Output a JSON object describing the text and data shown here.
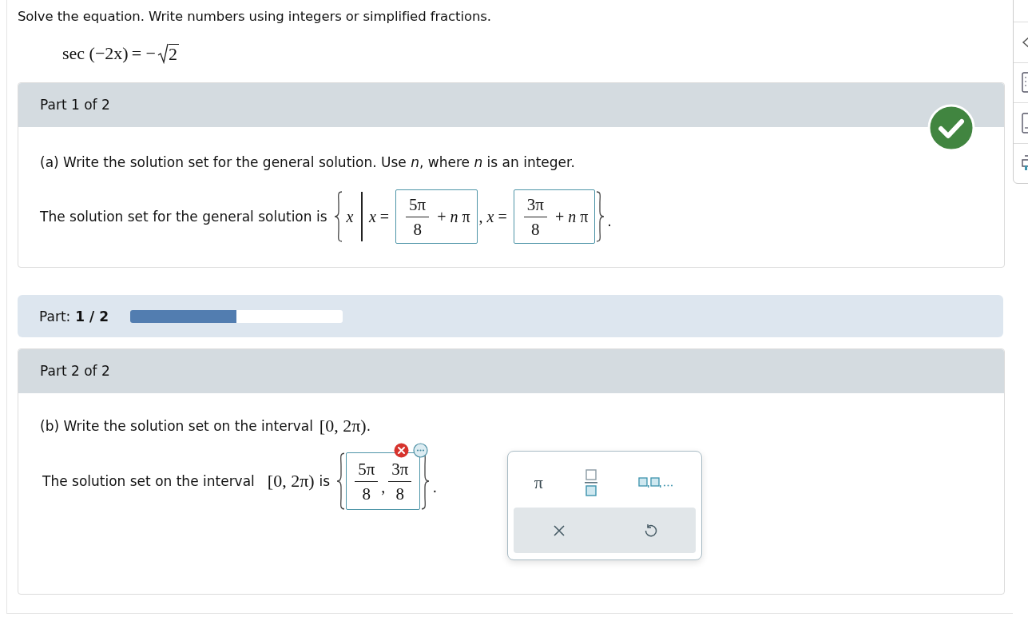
{
  "problem": {
    "instructions": "Solve the equation. Write numbers using integers or simplified fractions.",
    "equation": {
      "function": "sec",
      "argument": "(−2x)",
      "relation": "= −",
      "radicand": "2"
    }
  },
  "part_1": {
    "header": "Part 1 of 2",
    "correct": true,
    "prompt": "(a) Write the solution set for the general solution. Use *n*, where *n* is an integer.",
    "lead": "The solution set for the general solution is",
    "variable": "x",
    "answers": [
      {
        "prefix": "*x* =",
        "numerator": "5π",
        "denominator": "8",
        "suffix": "+ *n* π"
      },
      {
        "prefix": ", *x* =",
        "numerator": "3π",
        "denominator": "8",
        "suffix": "+ *n* π"
      }
    ],
    "end": "."
  },
  "progress": {
    "label": "Part:",
    "value": "1 / 2",
    "level": 0.5
  },
  "part_2": {
    "header": "Part 2 of 2",
    "prompt": "(b) Write the solution set on the interval",
    "prompt_interval": "[0, 2π)",
    "prompt_end": ".",
    "lead": "The solution set on the interval",
    "interval": "[0, 2π)",
    "lead_end": "is",
    "correct": false,
    "answers": [
      {
        "numerator": "5π",
        "denominator": "8"
      },
      {
        "numerator": "3π",
        "denominator": "8"
      }
    ],
    "separator": ",",
    "end": "."
  },
  "keypad": {
    "keys": [
      {
        "kind": "symbol",
        "label": "π"
      },
      {
        "kind": "fraction"
      },
      {
        "kind": "list"
      }
    ],
    "actions": [
      {
        "kind": "clear"
      },
      {
        "kind": "undo"
      }
    ]
  }
}
